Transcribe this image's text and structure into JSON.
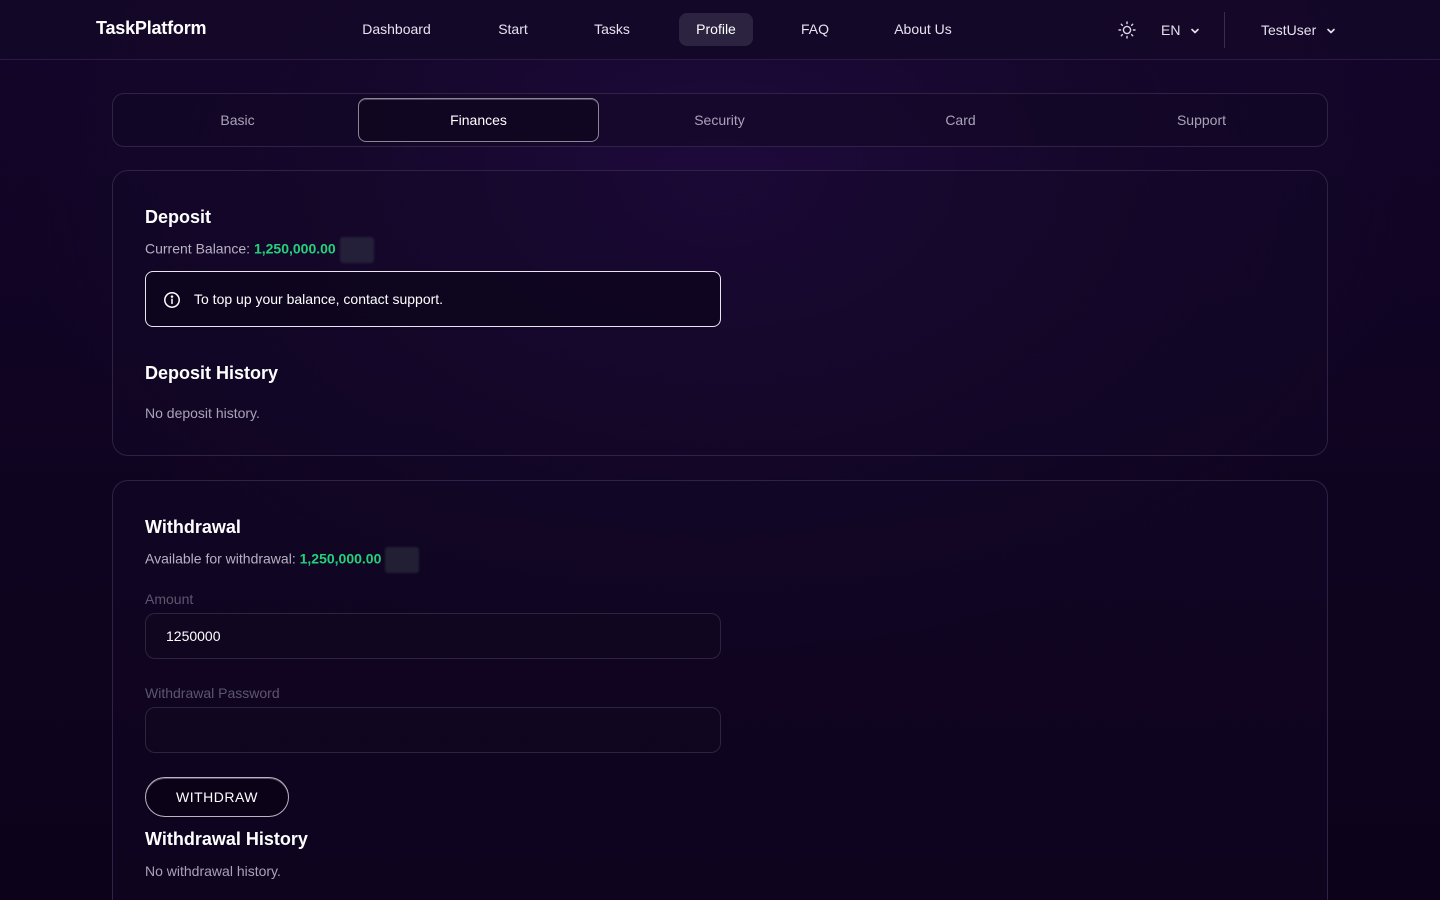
{
  "header": {
    "brand": "TaskPlatform",
    "nav": [
      {
        "label": "Dashboard",
        "active": false
      },
      {
        "label": "Start",
        "active": false
      },
      {
        "label": "Tasks",
        "active": false
      },
      {
        "label": "Profile",
        "active": true
      },
      {
        "label": "FAQ",
        "active": false
      },
      {
        "label": "About Us",
        "active": false
      }
    ],
    "theme_icon": "sun-icon",
    "language": "EN",
    "user": "TestUser"
  },
  "tabs": [
    {
      "label": "Basic",
      "active": false
    },
    {
      "label": "Finances",
      "active": true
    },
    {
      "label": "Security",
      "active": false
    },
    {
      "label": "Card",
      "active": false
    },
    {
      "label": "Support",
      "active": false
    }
  ],
  "deposit": {
    "title": "Deposit",
    "balance_label": "Current Balance:",
    "balance_value": "1,250,000.00",
    "info_icon": "info-icon",
    "info_text": "To top up your balance, contact support.",
    "history_title": "Deposit History",
    "history_empty": "No deposit history."
  },
  "withdrawal": {
    "title": "Withdrawal",
    "available_label": "Available for withdrawal:",
    "available_value": "1,250,000.00",
    "amount_label": "Amount",
    "amount_value": "1250000",
    "password_label": "Withdrawal Password",
    "password_value": "",
    "button_label": "WITHDRAW",
    "history_title": "Withdrawal History",
    "history_empty": "No withdrawal history."
  },
  "colors": {
    "accent_green": "#22d27a",
    "background": "#13052a",
    "border": "#2f2246"
  }
}
